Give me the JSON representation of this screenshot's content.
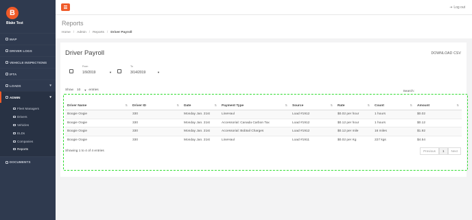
{
  "brand": {
    "logo_letter": "B",
    "user_name": "Blake Test"
  },
  "sidebar": {
    "items": [
      {
        "label": "MAP"
      },
      {
        "label": "DRIVER LOGS"
      },
      {
        "label": "VEHICLE INSPECTIONS"
      },
      {
        "label": "IFTA"
      },
      {
        "label": "LOADS"
      },
      {
        "label": "ADMIN"
      },
      {
        "label": "DOCUMENTS"
      }
    ],
    "admin_sub": [
      {
        "label": "Fleet Managers"
      },
      {
        "label": "Drivers"
      },
      {
        "label": "Vehicles"
      },
      {
        "label": "ELDs"
      },
      {
        "label": "Companies"
      },
      {
        "label": "Reports"
      }
    ]
  },
  "topbar": {
    "logout": "Log out",
    "accent": "#f05a28"
  },
  "page": {
    "title": "Reports",
    "breadcrumb": [
      "Home",
      "Admin",
      "Reports",
      "Driver Payroll"
    ]
  },
  "card": {
    "title": "Driver Payroll",
    "download": "DOWNLOAD CSV",
    "from_label": "From",
    "from_value": "1/9/2019",
    "to_label": "To",
    "to_value": "3/14/2019",
    "show_label": "Show",
    "show_value": "10",
    "entries_label": "entries",
    "search_label": "Search:",
    "info": "Showing 1 to 4 of 4 entries",
    "prev": "Previous",
    "page": "1",
    "next": "Next"
  },
  "table": {
    "headers": [
      "Driver Name",
      "Driver ID",
      "Date",
      "Payment Type",
      "Source",
      "Rate",
      "Count",
      "Amount"
    ],
    "rows": [
      [
        "Boogie Oogie",
        "330",
        "Monday Jan. 21st",
        "LineHaul",
        "Load #1912",
        "$0.02 per hour",
        "1 hours",
        "$0.02"
      ],
      [
        "Boogie Oogie",
        "330",
        "Monday Jan. 21st",
        "Accessorial: Canada Carbon Tax",
        "Load #1912",
        "$0.12 per hour",
        "1 hours",
        "$0.12"
      ],
      [
        "Boogie Oogie",
        "330",
        "Monday Jan. 21st",
        "Accessorial: Bobtail Charges",
        "Load #1912",
        "$0.12 per mile",
        "16 miles",
        "$1.92"
      ],
      [
        "Boogie Oogie",
        "330",
        "Monday Jan. 21st",
        "LineHaul",
        "Load #1911",
        "$0.02 per Kg",
        "227 kgs",
        "$4.54"
      ]
    ]
  }
}
